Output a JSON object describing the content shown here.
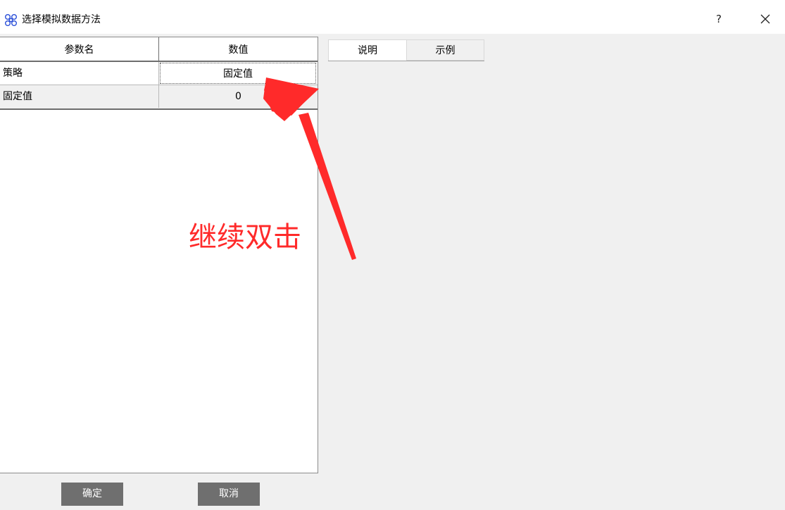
{
  "window": {
    "title": "选择模拟数据方法",
    "icon": "app-icon",
    "help_label": "?",
    "close_icon": "close-icon"
  },
  "table": {
    "headers": [
      "参数名",
      "数值"
    ],
    "rows": [
      {
        "name": "策略",
        "value": "固定值"
      },
      {
        "name": "固定值",
        "value": "0"
      }
    ]
  },
  "tabs": [
    {
      "label": "说明",
      "active": true
    },
    {
      "label": "示例",
      "active": false
    }
  ],
  "buttons": {
    "ok_label": "确定",
    "cancel_label": "取消"
  },
  "annotation": {
    "text": "继续双击",
    "color": "#ff2a2a"
  },
  "colors": {
    "button_bg": "#6f6f6f",
    "window_bg": "#f0f0f0",
    "titlebar_bg": "#ffffff",
    "icon_blue": "#2b4fd8"
  }
}
